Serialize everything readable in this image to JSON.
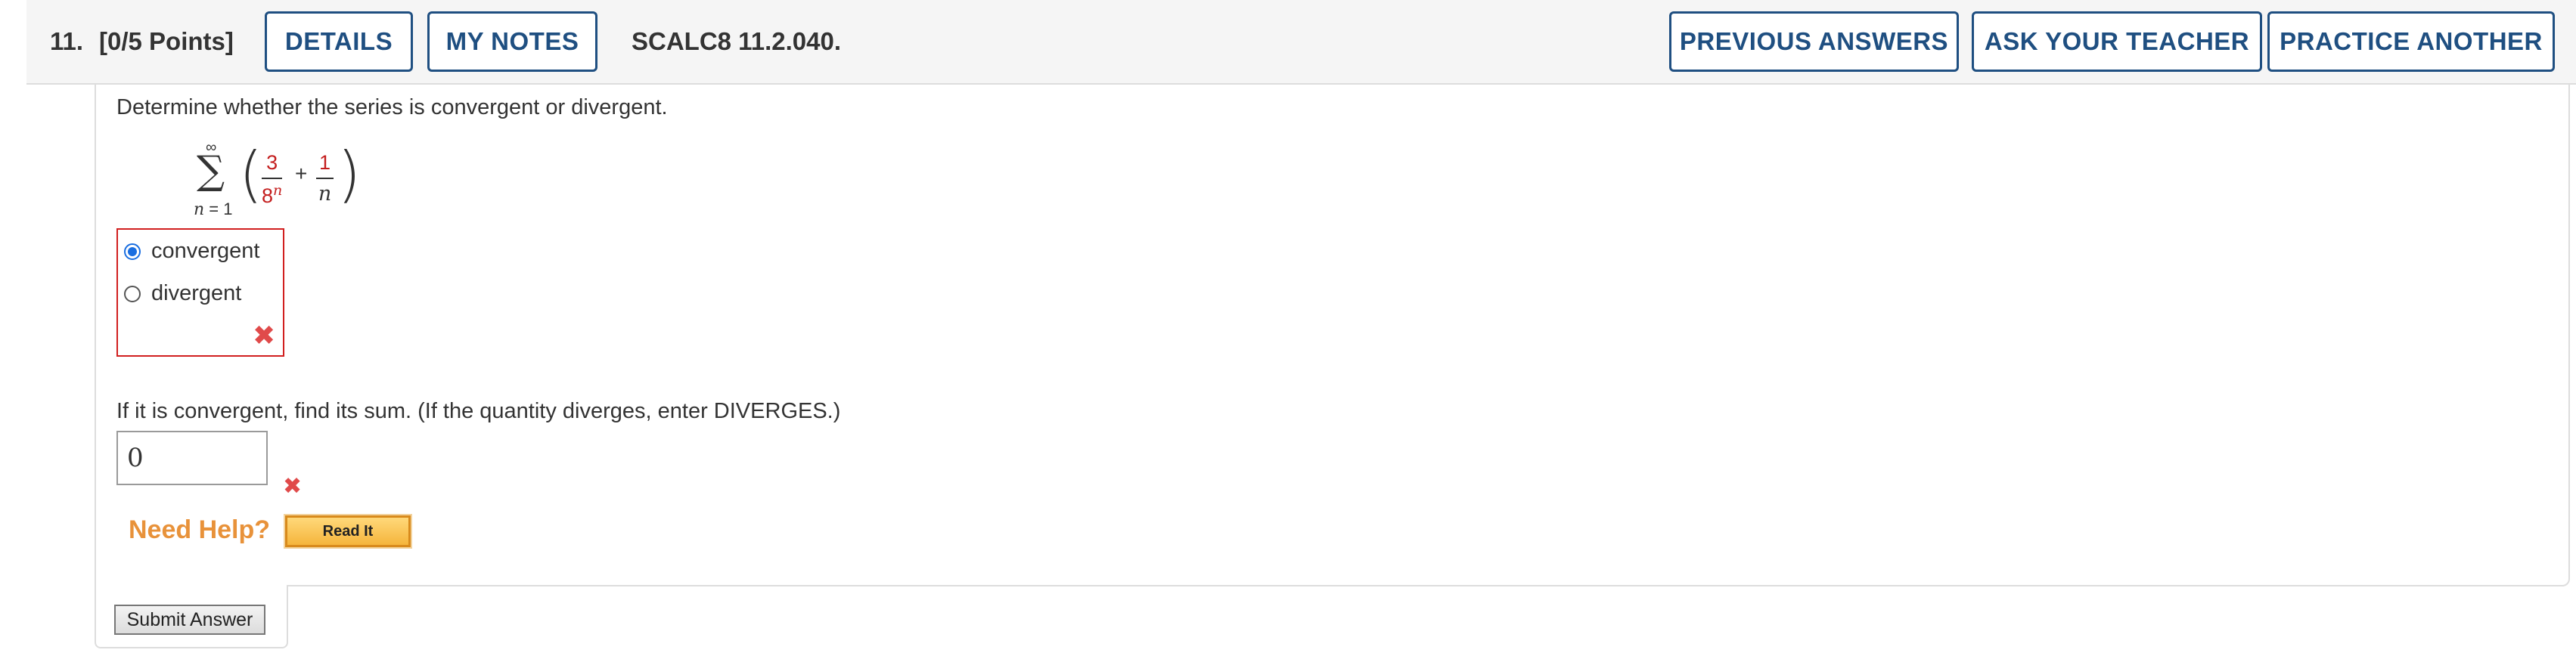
{
  "header": {
    "question_number": "11.",
    "points": "[0/5 Points]",
    "details_label": "DETAILS",
    "my_notes_label": "MY NOTES",
    "question_code": "SCALC8 11.2.040.",
    "previous_answers_label": "PREVIOUS ANSWERS",
    "ask_teacher_label": "ASK YOUR TEACHER",
    "practice_another_label": "PRACTICE ANOTHER"
  },
  "question": {
    "prompt": "Determine whether the series is convergent or divergent.",
    "series": {
      "upper_limit": "∞",
      "lower_limit_var": "n",
      "lower_limit_rest": " = 1",
      "term1_numerator": "3",
      "term1_denominator": "8",
      "term1_exponent": "n",
      "operator": "+",
      "term2_numerator": "1",
      "term2_denominator": "n"
    },
    "options": [
      {
        "label": "convergent",
        "selected": true
      },
      {
        "label": "divergent",
        "selected": false
      }
    ],
    "follow_up_prompt": "If it is convergent, find its sum. (If the quantity diverges, enter DIVERGES.)",
    "answer_value": "0"
  },
  "help": {
    "need_help_label": "Need Help?",
    "read_it_label": "Read It"
  },
  "submit_label": "Submit Answer",
  "colors": {
    "accent": "#1f4f81",
    "error": "#d11f1f",
    "help": "#e8923a"
  }
}
